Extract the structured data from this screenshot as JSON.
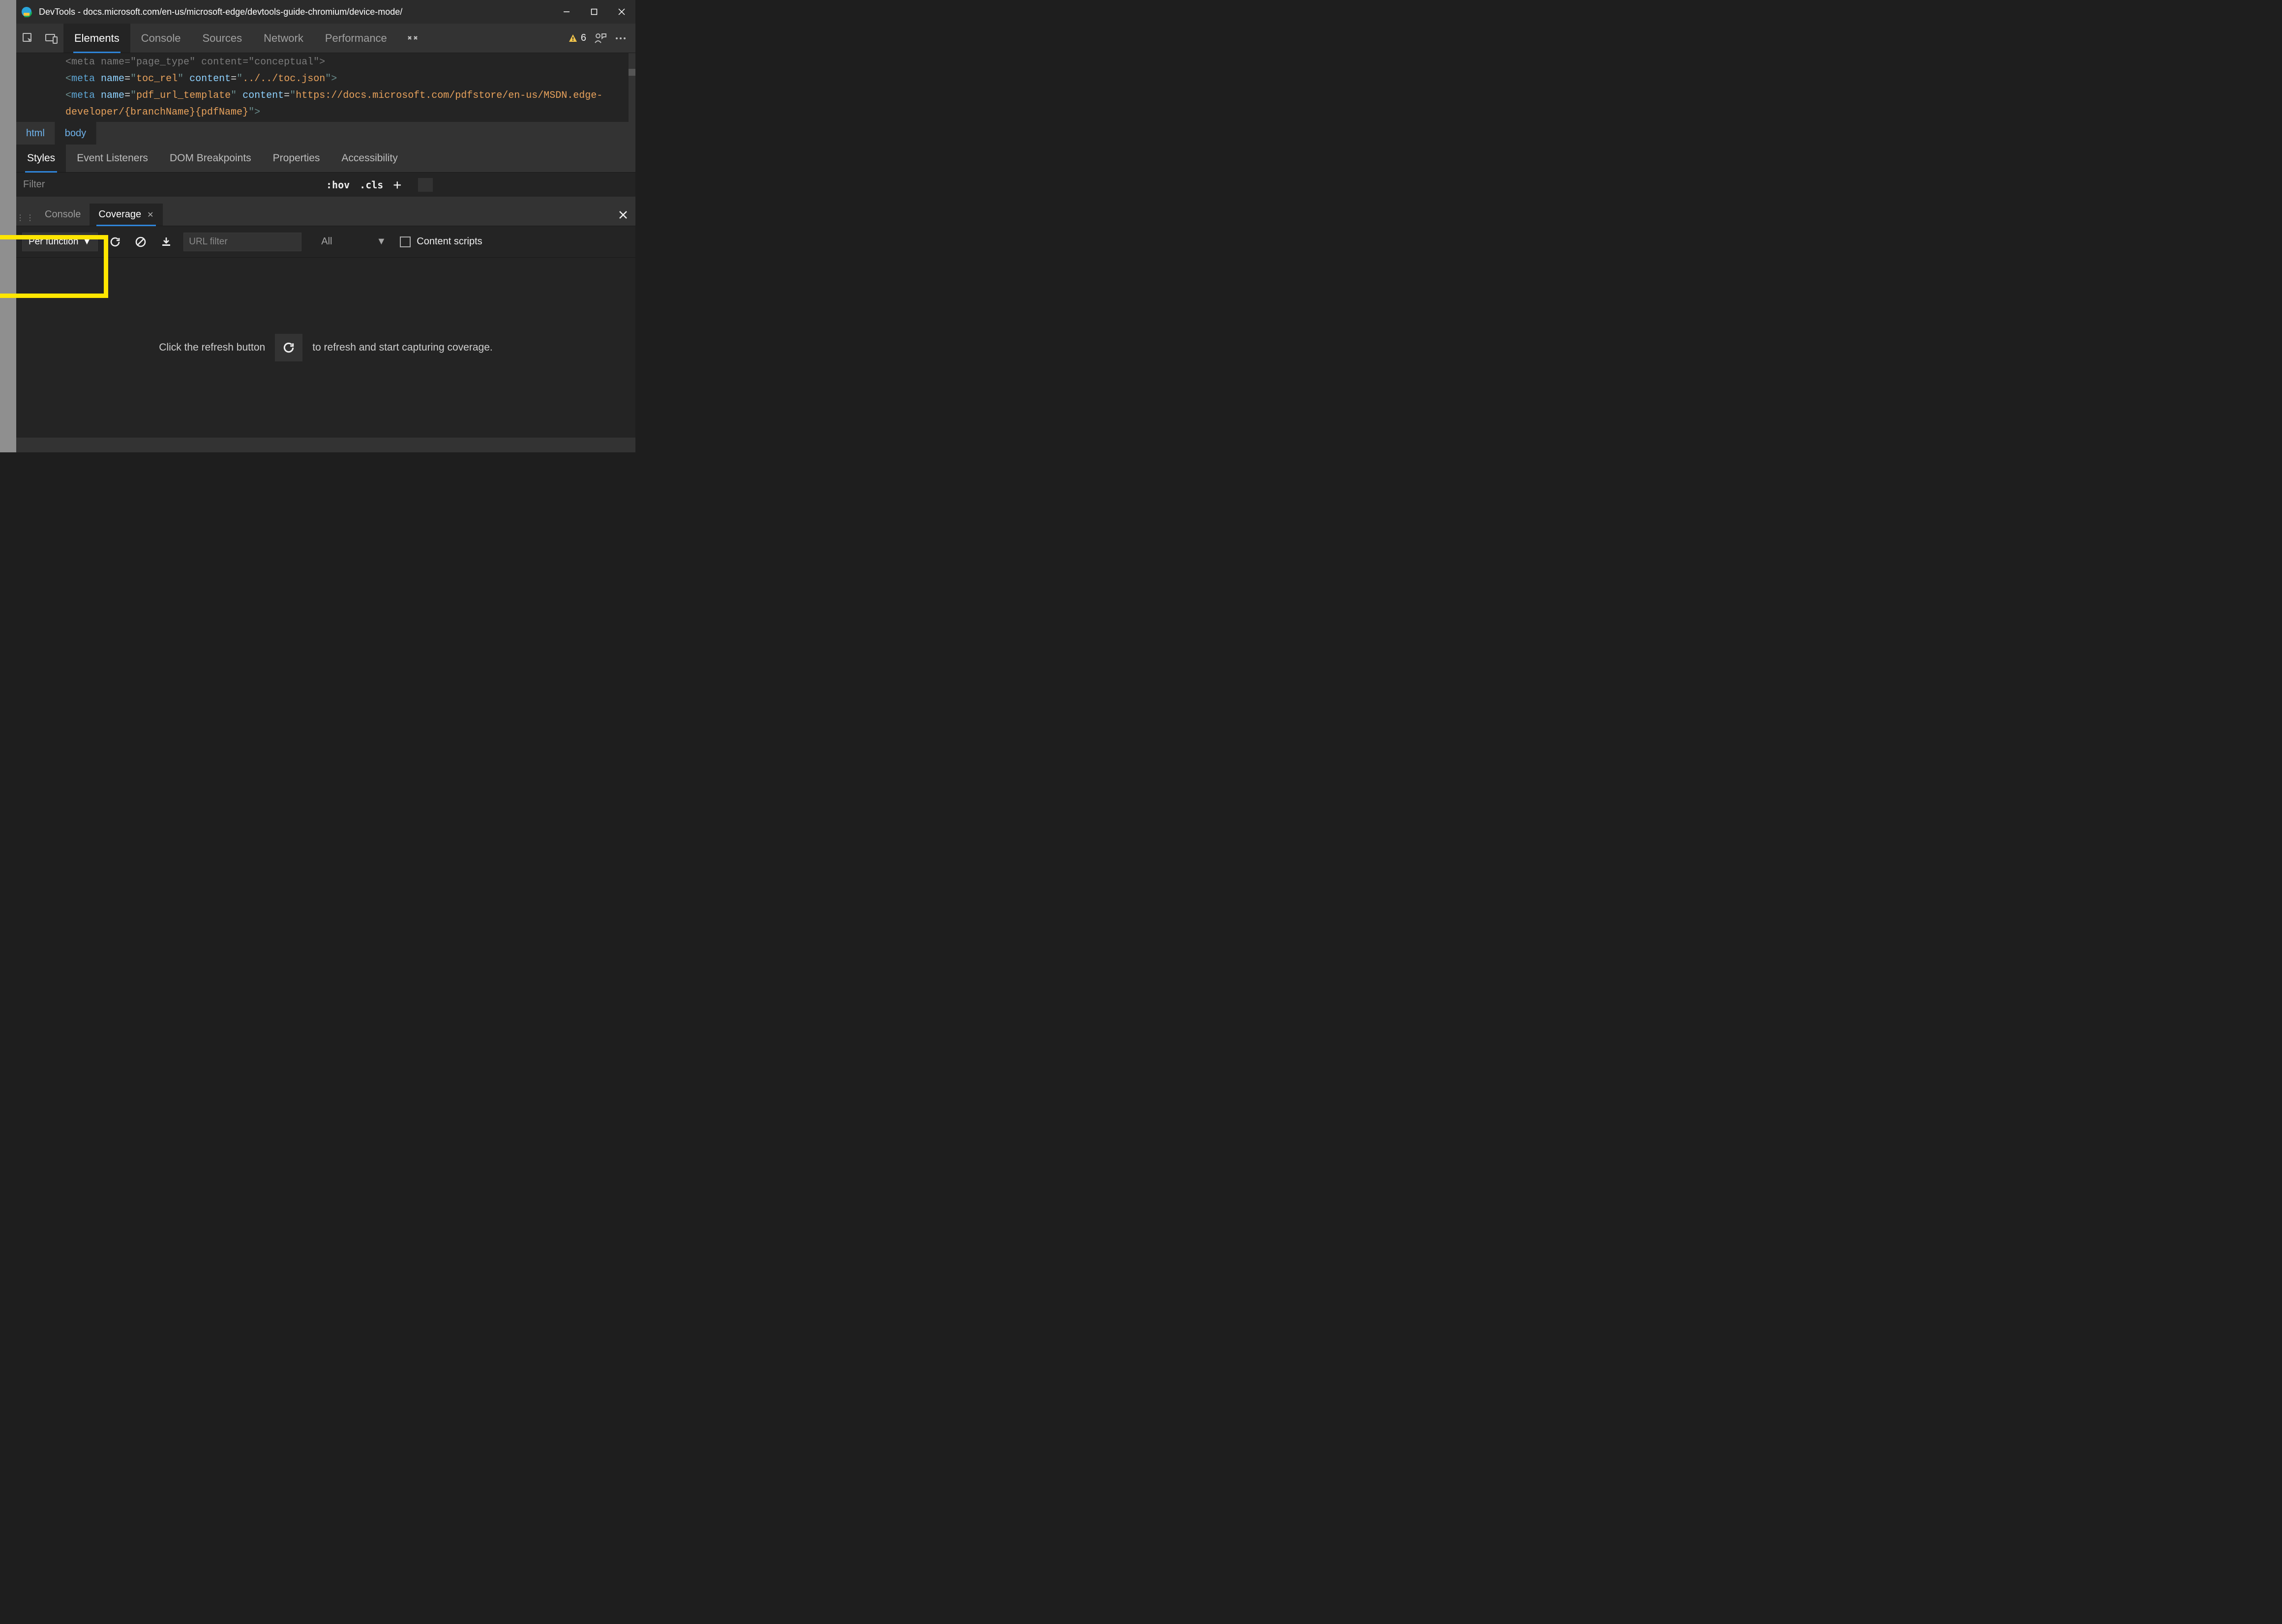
{
  "titlebar": {
    "title": "DevTools - docs.microsoft.com/en-us/microsoft-edge/devtools-guide-chromium/device-mode/"
  },
  "main_tabs": {
    "elements": "Elements",
    "console": "Console",
    "sources": "Sources",
    "network": "Network",
    "performance": "Performance"
  },
  "warnings": {
    "count": "6"
  },
  "code": {
    "line_cut_attr_name": "page_type",
    "line_cut_attr_val": "conceptual",
    "meta1_name": "toc_rel",
    "meta1_content": "../../toc.json",
    "meta2_name": "pdf_url_template",
    "meta2_content": "https://docs.microsoft.com/pdfstore/en-us/MSDN.edge-developer/{branchName}{pdfName}"
  },
  "breadcrumb": {
    "html": "html",
    "body": "body"
  },
  "sub_tabs": {
    "styles": "Styles",
    "event_listeners": "Event Listeners",
    "dom_breakpoints": "DOM Breakpoints",
    "properties": "Properties",
    "accessibility": "Accessibility"
  },
  "styles_row": {
    "filter_placeholder": "Filter",
    "hov": ":hov",
    "cls": ".cls"
  },
  "drawer": {
    "console": "Console",
    "coverage": "Coverage"
  },
  "coverage_toolbar": {
    "mode": "Per function",
    "url_filter_placeholder": "URL filter",
    "type": "All",
    "content_scripts": "Content scripts"
  },
  "coverage_body": {
    "msg_before": "Click the refresh button",
    "msg_after": "to refresh and start capturing coverage."
  }
}
